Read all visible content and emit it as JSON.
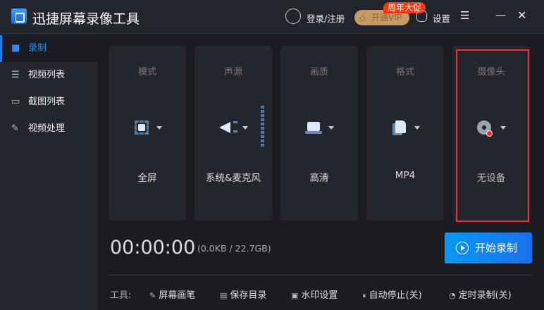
{
  "app": {
    "title": "迅捷屏幕录像工具",
    "login": "登录/注册",
    "vip": "开通VIP",
    "promo": "周年大促",
    "settings": "设置"
  },
  "sidebar": {
    "items": [
      {
        "label": "录制",
        "icon": "camera-icon"
      },
      {
        "label": "视频列表",
        "icon": "video-list-icon"
      },
      {
        "label": "截图列表",
        "icon": "screenshot-icon"
      },
      {
        "label": "视频处理",
        "icon": "tools-icon"
      }
    ]
  },
  "cards": [
    {
      "label": "模式",
      "value": "全屏"
    },
    {
      "label": "声源",
      "value": "系统&麦克风"
    },
    {
      "label": "画质",
      "value": "高清"
    },
    {
      "label": "格式",
      "value": "MP4"
    },
    {
      "label": "摄像头",
      "value": "无设备"
    }
  ],
  "status": {
    "timer": "00:00:00",
    "size": "(0.0KB / 22.7GB)"
  },
  "record_button": "开始录制",
  "tools": {
    "label": "工具:",
    "items": [
      "屏幕画笔",
      "保存目录",
      "水印设置",
      "自动停止(关)",
      "定时录制(关)"
    ]
  },
  "colors": {
    "accent": "#1a7cf0",
    "highlight": "#f33030"
  }
}
